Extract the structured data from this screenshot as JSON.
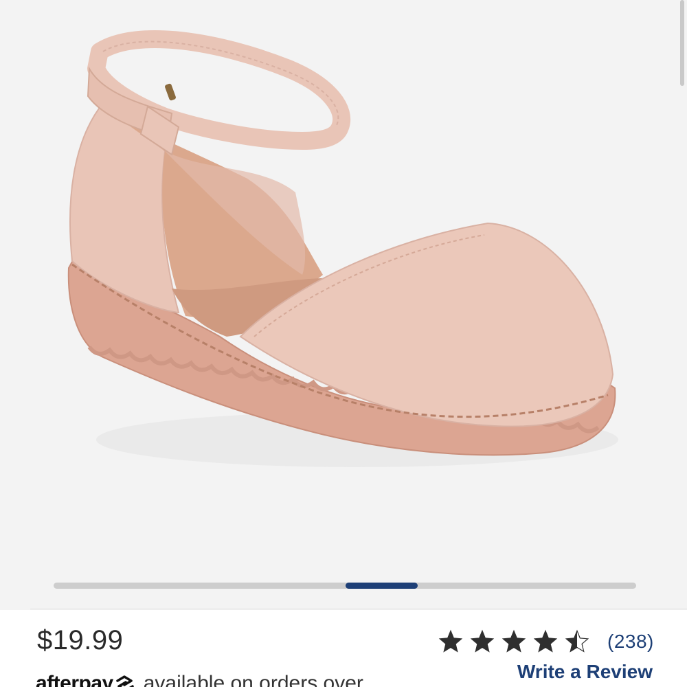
{
  "product": {
    "image_alt": "Blush pink faux-suede ankle-strap shoe",
    "colors": {
      "background": "#f3f3f3",
      "suede": "#e9c5b7",
      "sole": "#dca592",
      "lining": "#dba88d"
    }
  },
  "carousel": {
    "active_index": 5,
    "total": 8,
    "track_color": "#cdcdcd",
    "thumb_color": "#1d3f76"
  },
  "pricing": {
    "price": "$19.99"
  },
  "rating": {
    "stars": 4.5,
    "max_stars": 5,
    "review_count": "(238)",
    "star_icon": "star-icon",
    "star_color": "#2f2f2f"
  },
  "actions": {
    "write_review_label": "Write a Review"
  },
  "afterpay": {
    "logo_text": "afterpay",
    "logo_icon": "afterpay-arrows-icon",
    "message": "available on orders over"
  }
}
